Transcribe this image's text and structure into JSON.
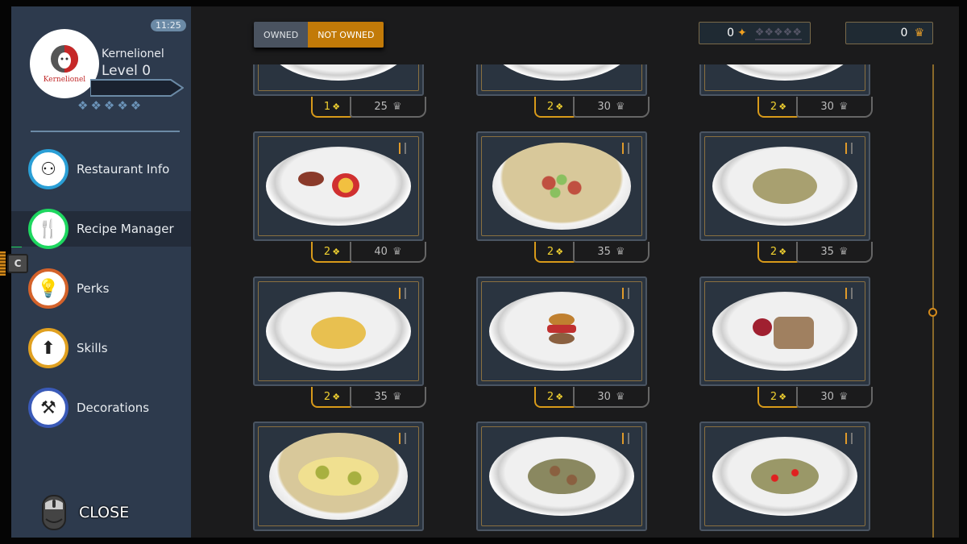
{
  "clock": "11:25",
  "user": {
    "name": "Kernelionel",
    "level": "Level 0",
    "logo_text": "Kernelionel",
    "stars": 5,
    "xp_progress": 0
  },
  "nav": [
    {
      "label": "Restaurant Info",
      "icon": "restaurant-icon",
      "color": "#2a9fd6",
      "active": false
    },
    {
      "label": "Recipe Manager",
      "icon": "cutlery-icon",
      "color": "#1ed760",
      "active": true
    },
    {
      "label": "Perks",
      "icon": "lightbulb-icon",
      "color": "#d4622a",
      "active": false
    },
    {
      "label": "Skills",
      "icon": "arrow-up-icon",
      "color": "#e0a020",
      "active": false
    },
    {
      "label": "Decorations",
      "icon": "hammer-icon",
      "color": "#3a5ab8",
      "active": false
    }
  ],
  "hotkey": "C",
  "close_label": "CLOSE",
  "filter": {
    "owned": "OWNED",
    "not_owned": "NOT OWNED",
    "selected": "NOT OWNED"
  },
  "counters": {
    "stars": "0",
    "chef_points": "0"
  },
  "colors": {
    "accent": "#c27a08",
    "sidebar": "#2d3a4d",
    "active_indicator": "#1ed760"
  },
  "recipes": [
    {
      "level": "1",
      "cost": "25",
      "dish": "plate"
    },
    {
      "level": "2",
      "cost": "30",
      "dish": "plate"
    },
    {
      "level": "2",
      "cost": "30",
      "dish": "plate"
    },
    {
      "level": "2",
      "cost": "40",
      "dish": "sausage-peaches"
    },
    {
      "level": "2",
      "cost": "35",
      "dish": "soup-sausage"
    },
    {
      "level": "2",
      "cost": "35",
      "dish": "pasta"
    },
    {
      "level": "2",
      "cost": "35",
      "dish": "gnocchi"
    },
    {
      "level": "2",
      "cost": "30",
      "dish": "burger"
    },
    {
      "level": "2",
      "cost": "30",
      "dish": "meat-slices"
    },
    {
      "level": "",
      "cost": "",
      "dish": "corn-soup"
    },
    {
      "level": "",
      "cost": "",
      "dish": "mushroom-pasta"
    },
    {
      "level": "",
      "cost": "",
      "dish": "tomato-pasta"
    }
  ]
}
